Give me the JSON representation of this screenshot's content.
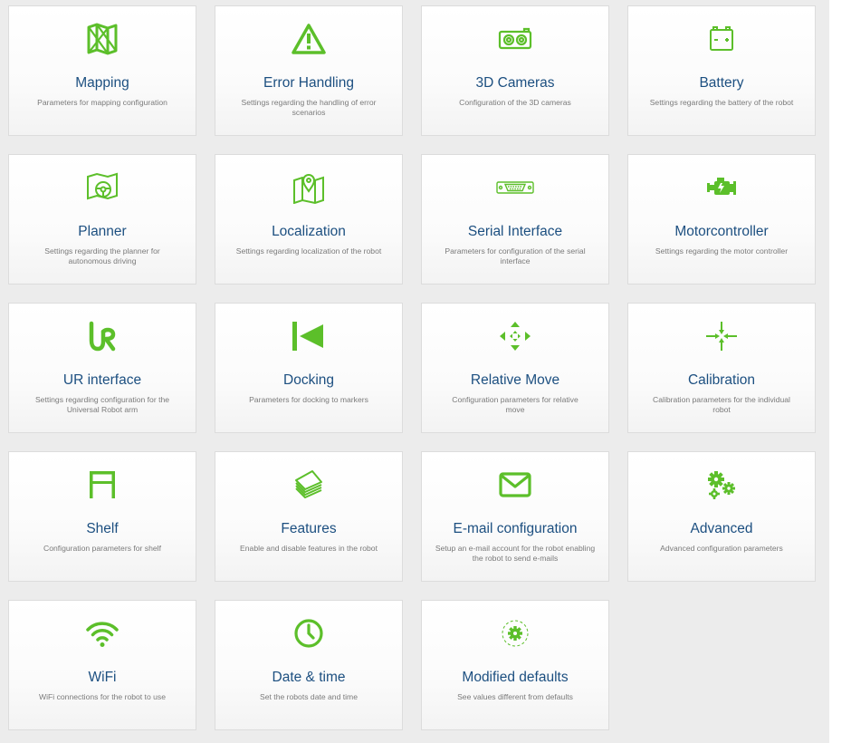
{
  "accent_color": "#5cbf2a",
  "cards": [
    {
      "id": "mapping",
      "title": "Mapping",
      "description": "Parameters for mapping configuration",
      "icon": "map-icon"
    },
    {
      "id": "error-handling",
      "title": "Error Handling",
      "description": "Settings regarding the handling of error scenarios",
      "icon": "warning-icon"
    },
    {
      "id": "3d-cameras",
      "title": "3D Cameras",
      "description": "Configuration of the 3D cameras",
      "icon": "camera-3d-icon"
    },
    {
      "id": "battery",
      "title": "Battery",
      "description": "Settings regarding the battery of the robot",
      "icon": "battery-icon"
    },
    {
      "id": "planner",
      "title": "Planner",
      "description": "Settings regarding the planner for autonomous driving",
      "icon": "planner-wheel-icon"
    },
    {
      "id": "localization",
      "title": "Localization",
      "description": "Settings regarding localization of the robot",
      "icon": "map-pin-icon"
    },
    {
      "id": "serial-interface",
      "title": "Serial Interface",
      "description": "Parameters for configuration of the serial interface",
      "icon": "serial-port-icon"
    },
    {
      "id": "motorcontroller",
      "title": "Motorcontroller",
      "description": "Settings regarding the motor controller",
      "icon": "engine-icon"
    },
    {
      "id": "ur-interface",
      "title": "UR interface",
      "description": "Settings regarding configuration for the Universal Robot arm",
      "icon": "ur-logo-icon"
    },
    {
      "id": "docking",
      "title": "Docking",
      "description": "Parameters for docking to markers",
      "icon": "docking-icon"
    },
    {
      "id": "relative-move",
      "title": "Relative Move",
      "description": "Configuration parameters for relative move",
      "icon": "move-arrows-icon"
    },
    {
      "id": "calibration",
      "title": "Calibration",
      "description": "Calibration parameters for the individual robot",
      "icon": "calibration-arrows-icon"
    },
    {
      "id": "shelf",
      "title": "Shelf",
      "description": "Configuration parameters for shelf",
      "icon": "shelf-icon"
    },
    {
      "id": "features",
      "title": "Features",
      "description": "Enable and disable features in the robot",
      "icon": "layers-icon"
    },
    {
      "id": "email-configuration",
      "title": "E-mail configuration",
      "description": "Setup an e-mail account for the robot enabling the robot to send e-mails",
      "icon": "envelope-icon"
    },
    {
      "id": "advanced",
      "title": "Advanced",
      "description": "Advanced configuration parameters",
      "icon": "gears-icon"
    },
    {
      "id": "wifi",
      "title": "WiFi",
      "description": "WiFi connections for the robot to use",
      "icon": "wifi-icon"
    },
    {
      "id": "date-time",
      "title": "Date & time",
      "description": "Set the robots date and time",
      "icon": "clock-icon"
    },
    {
      "id": "modified-defaults",
      "title": "Modified defaults",
      "description": "See values different from defaults",
      "icon": "gear-outline-icon"
    }
  ]
}
